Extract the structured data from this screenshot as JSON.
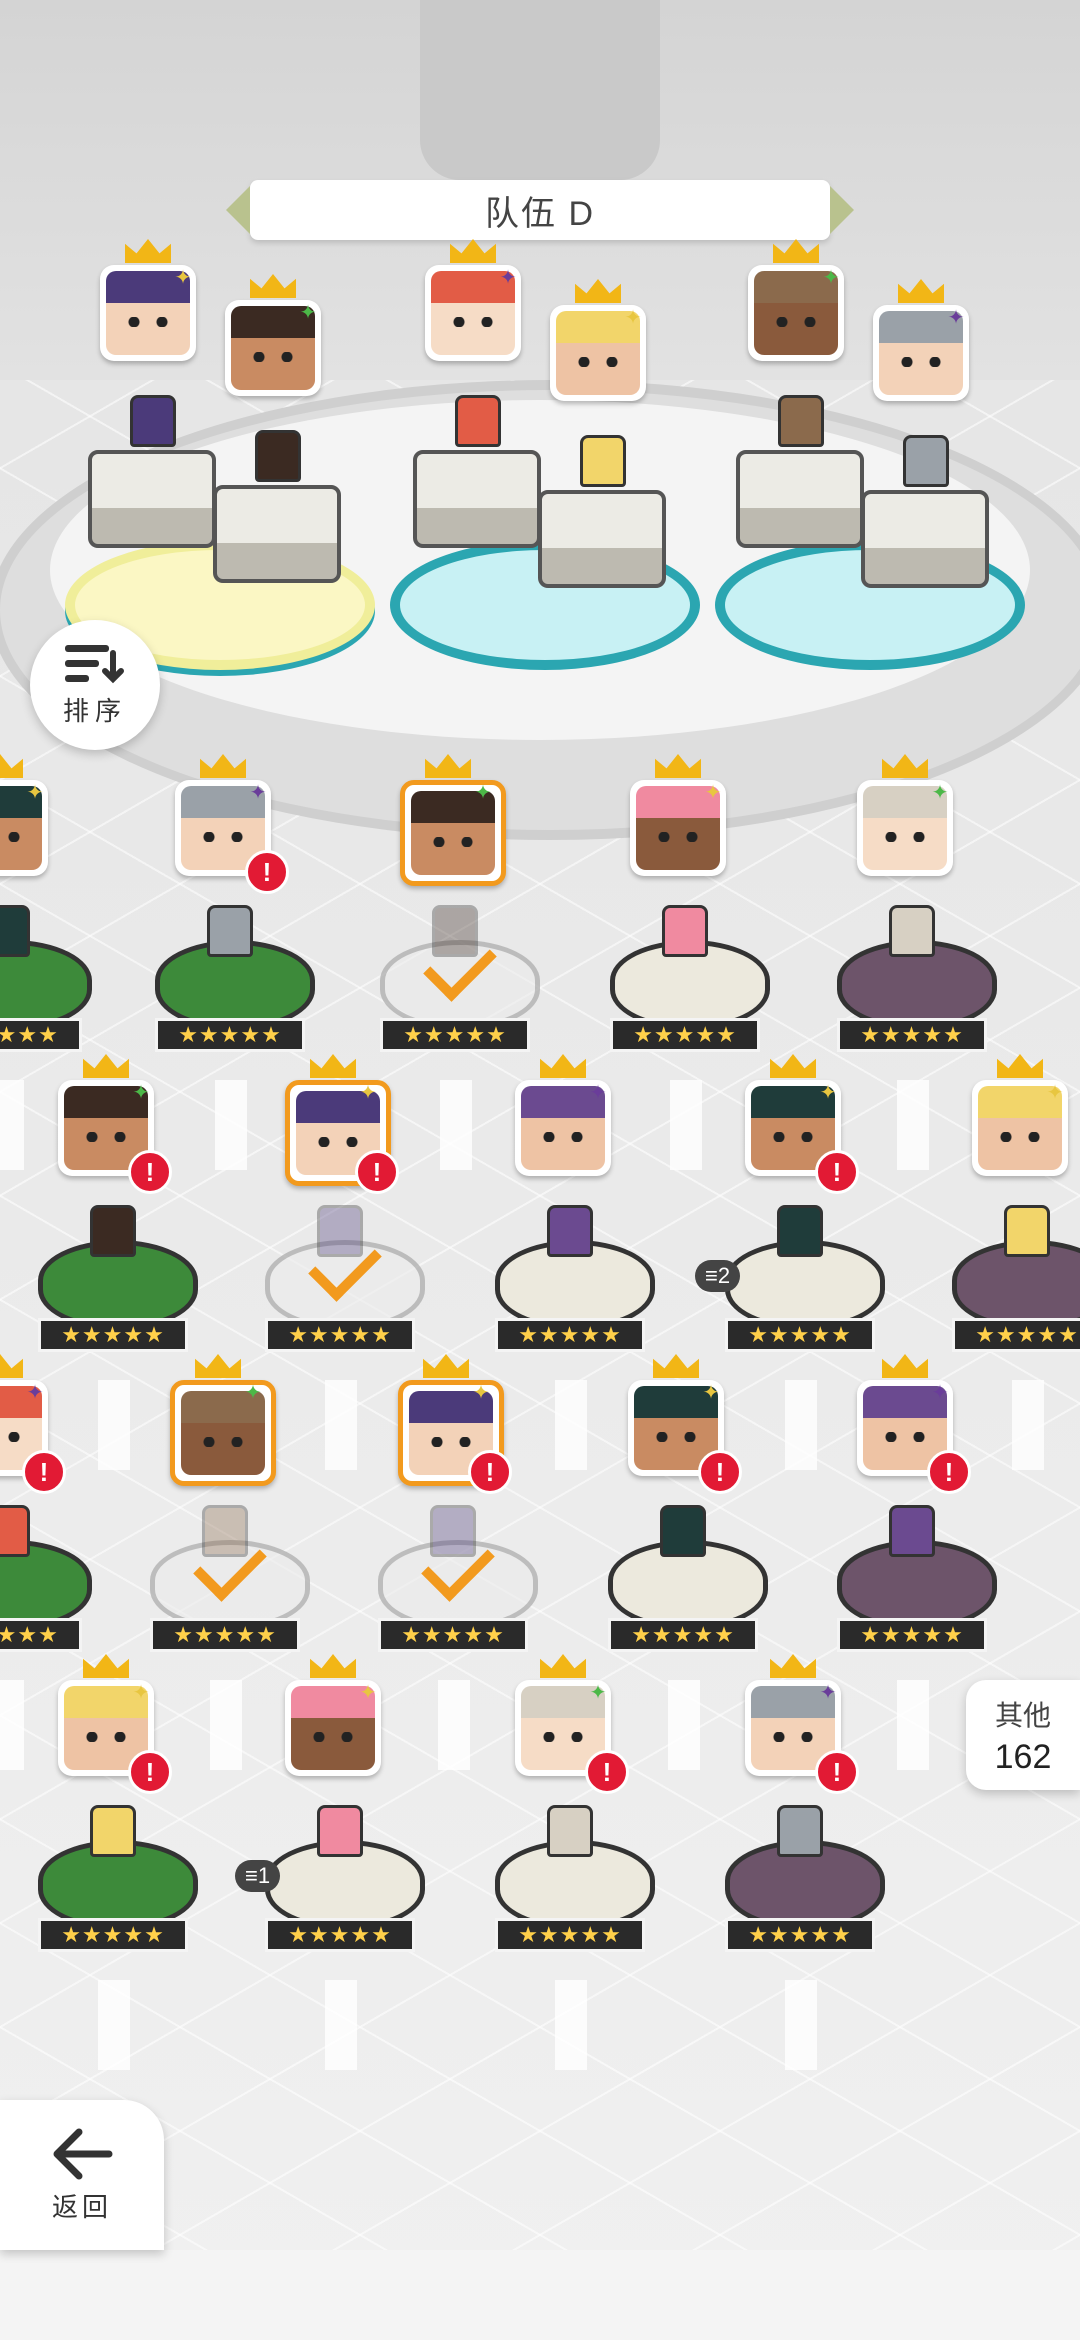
{
  "team": {
    "name": "队伍 D"
  },
  "controls": {
    "sort_label": "排序",
    "back_label": "返回",
    "others_label": "其他",
    "others_count": "162"
  },
  "roster": {
    "star_text": "★★★★★",
    "alert_symbol": "!",
    "copy_badges": [
      "2",
      "1"
    ]
  },
  "icons": [
    "sort-icon",
    "back-arrow-icon",
    "crown-icon",
    "element-icon",
    "alert-icon",
    "check-icon",
    "copy-badge-icon"
  ],
  "colors": {
    "accent_orange": "#f29a1e",
    "alert_red": "#e21a34",
    "crown_gold": "#f2b616",
    "pad_teal": "#2ba6b1"
  }
}
